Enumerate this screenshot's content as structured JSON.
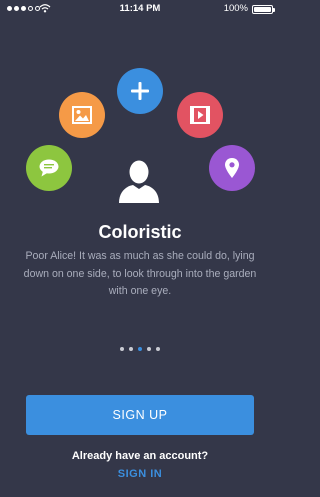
{
  "status_bar": {
    "time": "11:14 PM",
    "battery": "100%"
  },
  "icons": {
    "add": "plus-icon",
    "image": "image-icon",
    "video": "video-icon",
    "chat": "chat-icon",
    "location": "location-pin-icon",
    "user": "user-avatar-icon"
  },
  "onboarding": {
    "title": "Coloristic",
    "description": "Poor Alice! It was as much as she could do, lying down on one side, to look through into the garden with one eye.",
    "page_count": 5,
    "active_page": 3
  },
  "actions": {
    "signup_label": "SIGN UP",
    "already_text": "Already have an account?",
    "signin_label": "SIGN IN"
  },
  "colors": {
    "background": "#343749",
    "accent": "#3b8fdf",
    "orange": "#f59a47",
    "red": "#e25362",
    "green": "#8dc63f",
    "purple": "#9a57d3"
  }
}
